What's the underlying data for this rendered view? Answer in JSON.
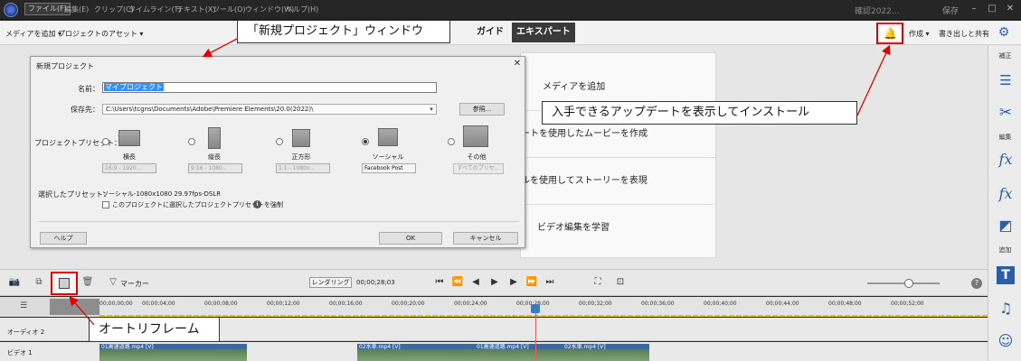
{
  "menubar": {
    "items": [
      "ファイル(F)",
      "編集(E)",
      "クリップ(C)",
      "タイムライン(T)",
      "テキスト(X)",
      "ツール(O)",
      "ウィンドウ(W)",
      "ヘルプ(H)"
    ],
    "window_title": "確認2022...",
    "save_label": "保存"
  },
  "topbar": {
    "add_media": "メディアを追加 ▾",
    "project_assets": "プロジェクトのアセット ▾",
    "tab_guide": "ガイド",
    "tab_expert": "エキスパート",
    "create": "作成 ▾",
    "export": "書き出しと共有"
  },
  "guide_panel": {
    "rows": [
      "メディアを追加",
      "ートを使用したムービーを作成",
      "ルを使用してストーリーを表現",
      "ビデオ編集を学習"
    ]
  },
  "dialog": {
    "title": "新規プロジェクト",
    "name_label": "名前：",
    "name_value": "マイプロジェクト",
    "location_label": "保存先：",
    "location_value": "C:\\Users\\tcgns\\Documents\\Adobe\\Premiere Elements\\20.0(2022)\\",
    "browse": "参照...",
    "preset_label": "プロジェクトプリセット：",
    "presets": [
      {
        "name": "横長",
        "select": "16:9 - 1920..."
      },
      {
        "name": "縦長",
        "select": "9:16 - 1080..."
      },
      {
        "name": "正方形",
        "select": "1:1 - 1080x..."
      },
      {
        "name": "ソーシャル",
        "select": "Facebook Post"
      },
      {
        "name": "その他",
        "select": "すべてのプリセ..."
      }
    ],
    "selected_label": "選択したプリセット：",
    "selected_value": "ソーシャル-1080x1080 29.97fps-DSLR",
    "force_label": "このプロジェクトに選択したプロジェクトプリセットを強制",
    "help": "ヘルプ",
    "ok": "OK",
    "cancel": "キャンセル"
  },
  "right_panel": {
    "labels": [
      "補正",
      "編集",
      "追加"
    ]
  },
  "timeline": {
    "marker": "マーカー",
    "render": "レンダリング",
    "time": "00;00;28;03",
    "ticks": [
      "00;00;00;00",
      "00;00;04;00",
      "00;00;08;00",
      "00;00;12;00",
      "00;00;16;00",
      "00;00;20;00",
      "00;00;24;00",
      "00;00;28;00",
      "00;00;32;00",
      "00;00;36;00",
      "00;00;40;00",
      "00;00;44;00",
      "00;00;48;00",
      "00;00;52;00"
    ],
    "tracks": [
      "オーディオ 2",
      "ビデオ 1"
    ],
    "clips": [
      "01高速道路.mp4 [V]",
      "02水車.mp4 [V]",
      "01高速道路.mp4 [V]",
      "02水車.mp4 [V]"
    ]
  },
  "callouts": {
    "dialog": "「新規プロジェクト」ウィンドウ",
    "update": "入手できるアップデートを表示してインストール",
    "reframe": "オートリフレーム"
  }
}
